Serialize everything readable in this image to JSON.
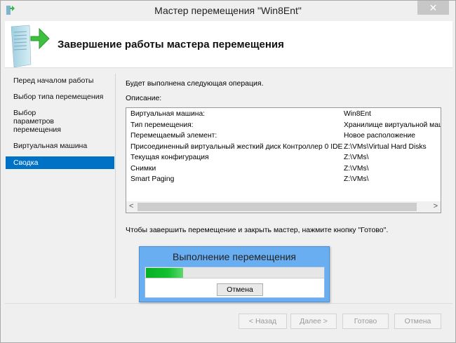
{
  "window": {
    "title": "Мастер перемещения \"Win8Ent\"",
    "close_glyph": "✕"
  },
  "header": {
    "title": "Завершение работы мастера перемещения"
  },
  "sidebar": {
    "items": [
      {
        "label": "Перед началом работы",
        "selected": false
      },
      {
        "label": "Выбор типа перемещения",
        "selected": false
      },
      {
        "label": "Выбор параметров перемещения",
        "selected": false
      },
      {
        "label": "Виртуальная машина",
        "selected": false
      },
      {
        "label": "Сводка",
        "selected": true
      }
    ]
  },
  "main": {
    "intro": "Будет выполнена следующая операция.",
    "description_label": "Описание:",
    "rows": [
      {
        "key": "Виртуальная машина:",
        "value": "Win8Ent"
      },
      {
        "key": "Тип перемещения:",
        "value": "Хранилище виртуальной маши"
      },
      {
        "key": "Перемещаемый элемент:",
        "value": "Новое расположение"
      },
      {
        "key": "Присоединенный виртуальный жесткий диск  Контроллер 0 IDE",
        "value": "Z:\\VMs\\Virtual Hard Disks"
      },
      {
        "key": "Текущая конфигурация",
        "value": "Z:\\VMs\\"
      },
      {
        "key": "Снимки",
        "value": "Z:\\VMs\\"
      },
      {
        "key": "Smart Paging",
        "value": "Z:\\VMs\\"
      }
    ],
    "scroll_left": "<",
    "scroll_right": ">",
    "finish_text": "Чтобы завершить перемещение и закрыть мастер, нажмите кнопку \"Готово\"."
  },
  "progress": {
    "title": "Выполнение перемещения",
    "percent": 21,
    "cancel_label": "Отмена",
    "fill_color": "#06b025"
  },
  "footer": {
    "back": "< Назад",
    "next": "Далее >",
    "finish": "Готово",
    "cancel": "Отмена"
  }
}
